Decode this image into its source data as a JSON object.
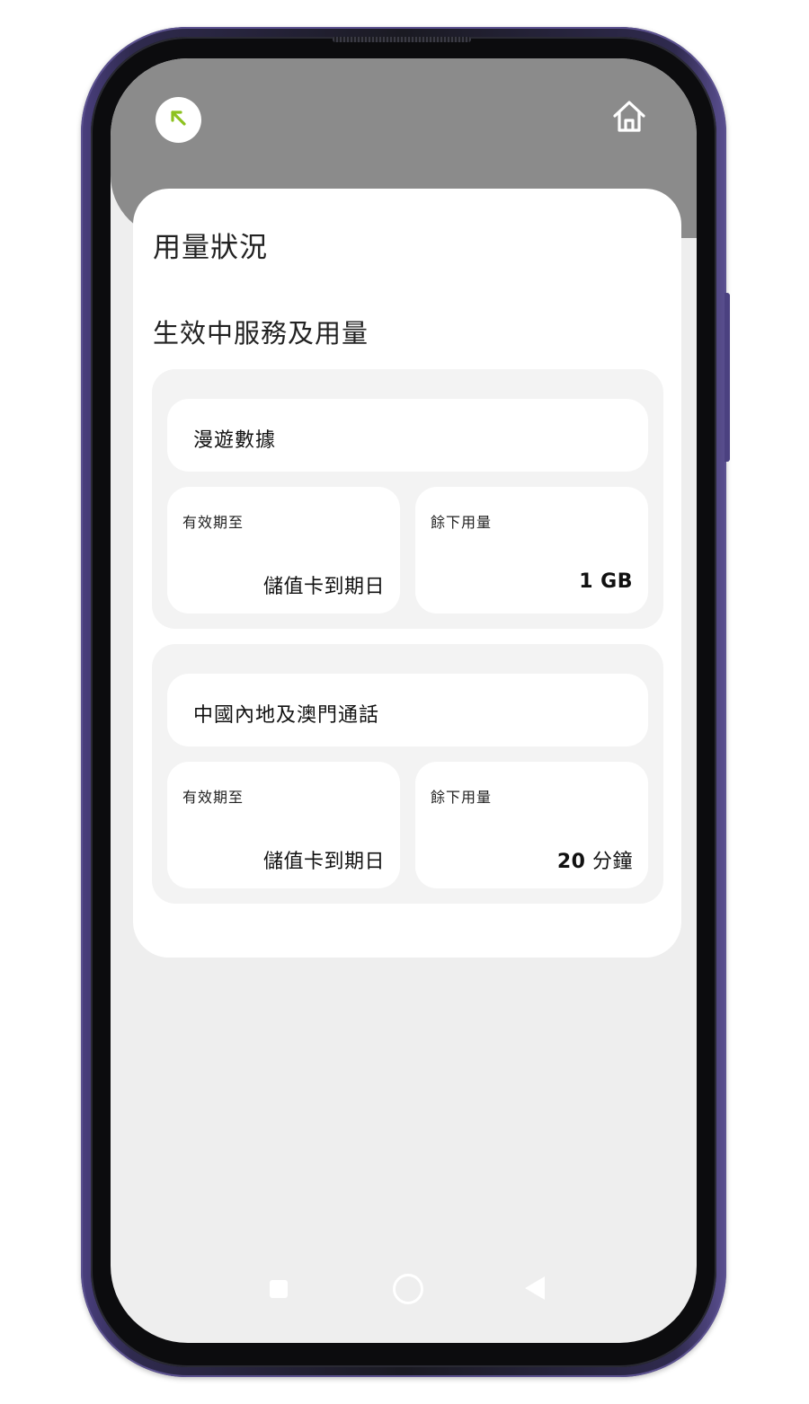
{
  "header": {
    "back_icon": "arrow-up-left-icon",
    "home_icon": "home-icon",
    "accent_color": "#8dc21f",
    "band_color": "#8b8b8b"
  },
  "page": {
    "title": "用量狀況",
    "section_title": "生效中服務及用量"
  },
  "services": [
    {
      "name": "漫遊數據",
      "expiry_label": "有效期至",
      "expiry_value": "儲值卡到期日",
      "remaining_label": "餘下用量",
      "remaining_number": "1 GB",
      "remaining_unit": ""
    },
    {
      "name": "中國內地及澳門通話",
      "expiry_label": "有效期至",
      "expiry_value": "儲值卡到期日",
      "remaining_label": "餘下用量",
      "remaining_number": "20",
      "remaining_unit": " 分鐘"
    }
  ],
  "nav": {
    "recent_icon": "square-icon",
    "home_icon": "circle-icon",
    "back_icon": "triangle-back-icon"
  }
}
